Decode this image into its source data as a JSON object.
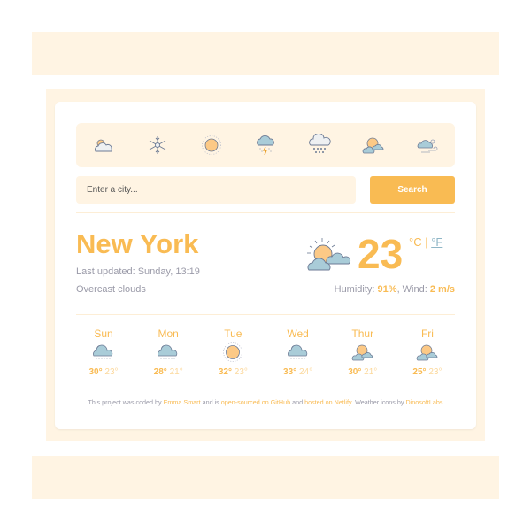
{
  "icon_bar": {
    "icons": [
      {
        "name": "partly-cloudy-icon"
      },
      {
        "name": "snowflake-icon"
      },
      {
        "name": "sun-icon"
      },
      {
        "name": "thunderstorm-icon"
      },
      {
        "name": "heavy-rain-icon"
      },
      {
        "name": "sun-behind-clouds-icon"
      },
      {
        "name": "windy-cloud-icon"
      }
    ]
  },
  "search": {
    "placeholder": "Enter a city...",
    "value": "",
    "button_label": "Search"
  },
  "current": {
    "city": "New York",
    "last_updated": "Last updated: Sunday, 13:19",
    "description": "Overcast clouds",
    "temperature": "23",
    "unit_c": "°C",
    "unit_sep": " | ",
    "unit_f": "°F",
    "humidity_label": "Humidity: ",
    "humidity": "91%",
    "wind_label": ", Wind: ",
    "wind": "2 m/s",
    "icon": "sun-behind-clouds-icon"
  },
  "forecast": [
    {
      "day": "Sun",
      "icon": "cloud-drizzle-icon",
      "high": "30°",
      "low": "23°"
    },
    {
      "day": "Mon",
      "icon": "cloud-drizzle-icon",
      "high": "28°",
      "low": "21°"
    },
    {
      "day": "Tue",
      "icon": "sun-icon",
      "high": "32°",
      "low": "23°"
    },
    {
      "day": "Wed",
      "icon": "cloud-drizzle-icon",
      "high": "33°",
      "low": "24°"
    },
    {
      "day": "Thur",
      "icon": "sun-behind-clouds-icon",
      "high": "30°",
      "low": "21°"
    },
    {
      "day": "Fri",
      "icon": "sun-behind-clouds-icon",
      "high": "25°",
      "low": "23°"
    }
  ],
  "footer": {
    "t1": "This project was coded by ",
    "author": "Emma Smart",
    "t2": " and is ",
    "source_link": "open-sourced on GitHub",
    "t3": " and ",
    "host_link": "hosted on Netlify",
    "t4": ". Weather icons by ",
    "icons_link": "DinosoftLabs"
  },
  "colors": {
    "accent": "#f9bb53",
    "panel": "#fff4e3",
    "cloud": "#a9ccd8",
    "sun": "#fcc986",
    "outline": "#6c7a94"
  }
}
